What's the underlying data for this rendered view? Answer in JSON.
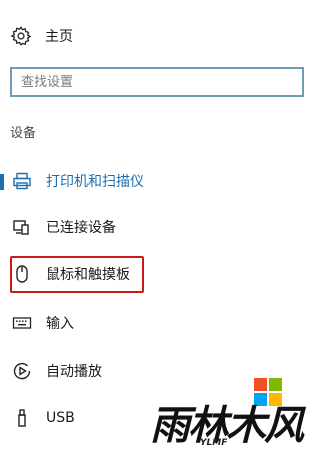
{
  "home": {
    "label": "主页",
    "icon": "gear-icon"
  },
  "search": {
    "placeholder": "查找设置",
    "value": ""
  },
  "section": {
    "title": "设备"
  },
  "items": [
    {
      "label": "打印机和扫描仪",
      "icon": "printer-icon",
      "active": true
    },
    {
      "label": "已连接设备",
      "icon": "devices-icon",
      "active": false
    },
    {
      "label": "鼠标和触摸板",
      "icon": "mouse-icon",
      "active": false,
      "highlighted": true
    },
    {
      "label": "输入",
      "icon": "keyboard-icon",
      "active": false
    },
    {
      "label": "自动播放",
      "icon": "autoplay-icon",
      "active": false
    },
    {
      "label": "USB",
      "icon": "usb-icon",
      "active": false
    }
  ],
  "watermark": {
    "text": "雨林木风",
    "subtext": "YLMF"
  },
  "colors": {
    "accent": "#1a6fb0",
    "highlight_border": "#cc1a1a",
    "search_border": "#6f9bb4"
  }
}
